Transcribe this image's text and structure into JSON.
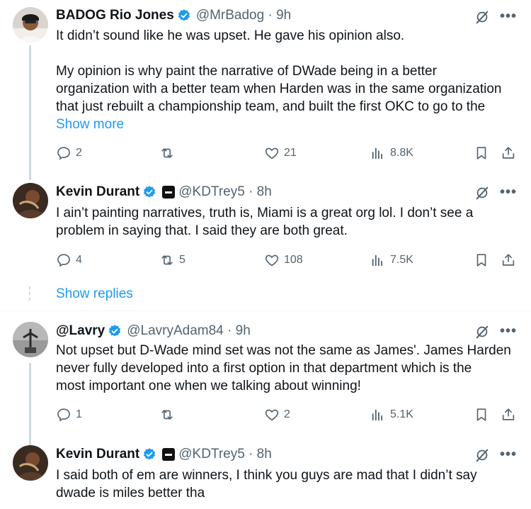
{
  "tweets": [
    {
      "name": "BADOG Rio Jones",
      "handle": "@MrBadog · 9h",
      "text_lines": [
        "It didn’t sound like he was upset. He gave his opinion also.",
        "",
        "My opinion is why paint the narrative of DWade being in a better",
        "organization with a better team when Harden was in the same organization",
        "that just rebuilt a championship team, and built the first OKC to go to the"
      ],
      "show_more": "Show more",
      "replies": "2",
      "reposts": "",
      "likes": "21",
      "views": "8.8K"
    },
    {
      "name": "Kevin Durant",
      "handle": "@KDTrey5 · 8h",
      "text_lines": [
        "I ain’t painting narratives, truth is, Miami is a great org lol. I don’t see a",
        "problem in saying that. I said they are both great."
      ],
      "replies": "4",
      "reposts": "5",
      "likes": "108",
      "views": "7.5K"
    },
    {
      "name": "@Lavry",
      "handle": "@LavryAdam84 · 9h",
      "text_lines": [
        "Not upset but D-Wade mind set was not the same as James'. James Harden",
        "never fully developed into a first option in that department which is the",
        "most important one when we talking about winning!"
      ],
      "replies": "1",
      "reposts": "",
      "likes": "2",
      "views": "5.1K"
    },
    {
      "name": "Kevin Durant",
      "handle": "@KDTrey5 · 8h",
      "text_lines": [
        "I said both of em are winners, I think you guys are mad that I didn’t say",
        "dwade is miles better tha"
      ]
    }
  ],
  "show_replies": "Show replies",
  "colors": {
    "accent": "#1d9bf0",
    "muted": "#536471",
    "verified": "#1d9bf0"
  },
  "icons": [
    "reply-icon",
    "repost-icon",
    "like-icon",
    "views-icon",
    "bookmark-icon",
    "share-icon",
    "grok-icon",
    "more-icon",
    "verified-badge-icon"
  ]
}
